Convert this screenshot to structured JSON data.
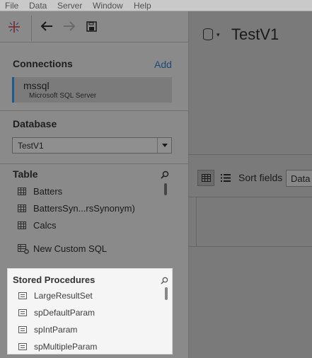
{
  "menubar": {
    "items": [
      "File",
      "Data",
      "Server",
      "Window",
      "Help"
    ]
  },
  "toolbar": {
    "logo_icon": "tableau-logo-icon",
    "back_icon": "arrow-left-icon",
    "forward_icon": "arrow-right-icon",
    "save_icon": "save-icon"
  },
  "connections": {
    "title": "Connections",
    "add_label": "Add",
    "items": [
      {
        "name": "mssql",
        "type": "Microsoft SQL Server"
      }
    ]
  },
  "database": {
    "title": "Database",
    "selected": "TestV1"
  },
  "table": {
    "title": "Table",
    "items": [
      "Batters",
      "BattersSyn...rsSynonym)",
      "Calcs"
    ],
    "custom_sql_label": "New Custom SQL"
  },
  "stored_procedures": {
    "title": "Stored Procedures",
    "items": [
      "LargeResultSet",
      "spDefaultParam",
      "spIntParam",
      "spMultipleParam"
    ]
  },
  "datasource": {
    "name": "TestV1",
    "sort_label": "Sort fields",
    "sort_value": "Data"
  },
  "colors": {
    "accent": "#1f5a8c",
    "highlight_panel": "#f5f5f5"
  }
}
